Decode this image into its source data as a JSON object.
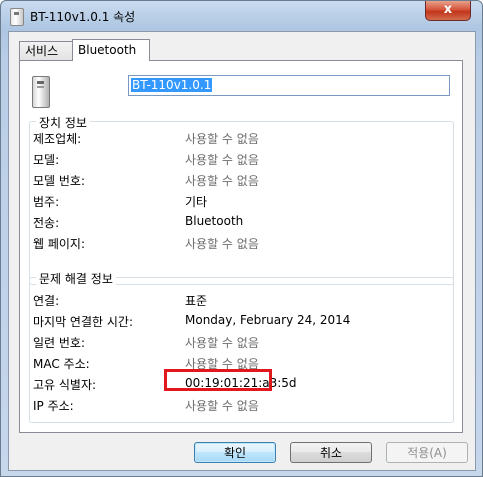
{
  "window": {
    "title": "BT-110v1.0.1 속성",
    "close_label": "x"
  },
  "tabs": [
    {
      "label": "서비스"
    },
    {
      "label": "Bluetooth"
    }
  ],
  "device_name": "BT-110v1.0.1",
  "device_info": {
    "title": "장치 정보",
    "rows": [
      {
        "key": "제조업체:",
        "value": "사용할 수 없음"
      },
      {
        "key": "모델:",
        "value": "사용할 수 없음"
      },
      {
        "key": "모델 번호:",
        "value": "사용할 수 없음"
      },
      {
        "key": "범주:",
        "value": "기타"
      },
      {
        "key": "전송:",
        "value": "Bluetooth"
      },
      {
        "key": "웹 페이지:",
        "value": "사용할 수 없음"
      }
    ]
  },
  "troubleshoot": {
    "title": "문제 해결 정보",
    "rows": [
      {
        "key": "연결:",
        "value": "표준"
      },
      {
        "key": "마지막 연결한 시간:",
        "value": "Monday, February 24, 2014"
      },
      {
        "key": "일련 번호:",
        "value": "사용할 수 없음"
      },
      {
        "key": "MAC 주소:",
        "value": "사용할 수 없음"
      },
      {
        "key": "고유 식별자:",
        "value": "00:19:01:21:a3:5d"
      },
      {
        "key": "IP 주소:",
        "value": "사용할 수 없음"
      }
    ]
  },
  "buttons": {
    "ok": "확인",
    "cancel": "취소",
    "apply": "적용(A)"
  },
  "colors": {
    "highlight_border": "#e0171c",
    "selection": "#3399ff"
  }
}
